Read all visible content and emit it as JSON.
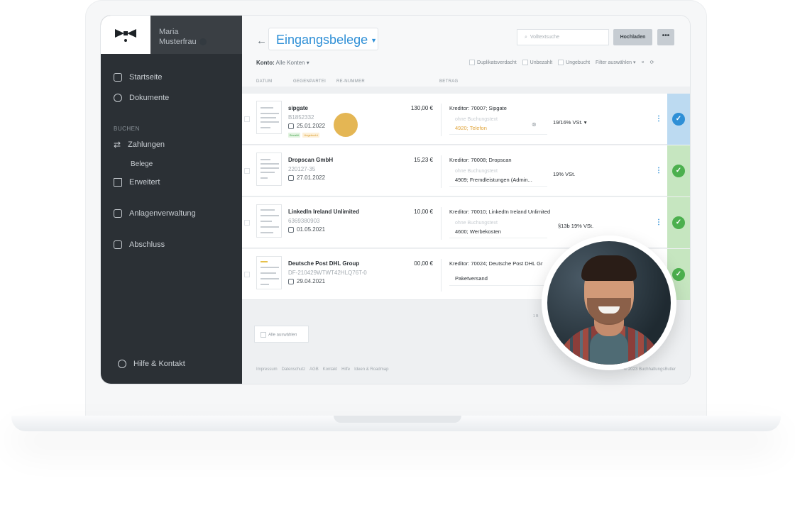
{
  "user": {
    "first_name": "Maria",
    "last_name": "Musterfrau"
  },
  "nav": {
    "home": "Startseite",
    "documents": "Dokumente",
    "section_booking": "BUCHEN",
    "payments": "Zahlungen",
    "receipts": "Belege",
    "advanced": "Erweitert",
    "assets": "Anlagenverwaltung",
    "closing": "Abschluss",
    "help": "Hilfe & Kontakt"
  },
  "header": {
    "back": "←",
    "title": "Eingangsbelege",
    "search_placeholder": "Volltextsuche",
    "upload": "Hochladen",
    "more": "•••",
    "konto_label": "Konto:",
    "konto_value": "Alle Konten"
  },
  "filters": {
    "duplicate": "Duplikatsverdacht",
    "unpaid": "Unbezahlt",
    "unbooked": "Ungebucht",
    "select": "Filter auswählen",
    "clear": "×"
  },
  "columns": {
    "date": "DATUM",
    "party": "GEGENPARTEI",
    "number": "RE-NUMMER",
    "amount": "BETRAG"
  },
  "rows": [
    {
      "party": "sipgate",
      "number": "B1852332",
      "date": "25.01.2022",
      "amount": "130,00 €",
      "creditor": "Kreditor: 70007; Sipgate",
      "placeholder": "ohne Buchungstext",
      "account": "4920; Telefon",
      "vat": "19/16% VSt.",
      "badge_paid": "Bezahlt",
      "badge_unbooked": "Ungebucht",
      "status": "blue"
    },
    {
      "party": "Dropscan GmbH",
      "number": "220127-35",
      "date": "27.01.2022",
      "amount": "15,23 €",
      "creditor": "Kreditor: 70008; Dropscan",
      "placeholder": "ohne Buchungstext",
      "account": "4909; Fremdleistungen (Admin...",
      "vat": "19% VSt.",
      "status": "green"
    },
    {
      "party": "LinkedIn Ireland Unlimited",
      "number": "6369380903",
      "date": "01.05.2021",
      "amount": "10,00 €",
      "creditor": "Kreditor: 70010; LinkedIn Ireland Unlimited",
      "placeholder": "ohne Buchungstext",
      "account": "4600; Werbekosten",
      "vat": "§13b 19% VSt.",
      "status": "green"
    },
    {
      "party": "Deutsche Post DHL Group",
      "number": "DF-210429WTWT42HLQ76T-0",
      "date": "29.04.2021",
      "amount": "00,00 €",
      "creditor": "Kreditor: 70024; Deutsche Post DHL Gr",
      "placeholder": "",
      "account": "Paketversand",
      "vat": "",
      "status": "green"
    }
  ],
  "bottom": {
    "select_all": "Alle auswählen",
    "pager": "1 B"
  },
  "footer": {
    "links": [
      "Impressum",
      "Datenschutz",
      "AGB",
      "Kontakt",
      "Hilfe",
      "Ideen & Roadmap"
    ],
    "copyright": "© 2023 BuchhaltungsButler"
  },
  "colors": {
    "accent": "#2e8fd6",
    "sidebar": "#2b3035",
    "success": "#4cb04e",
    "warning": "#e0a43a"
  }
}
